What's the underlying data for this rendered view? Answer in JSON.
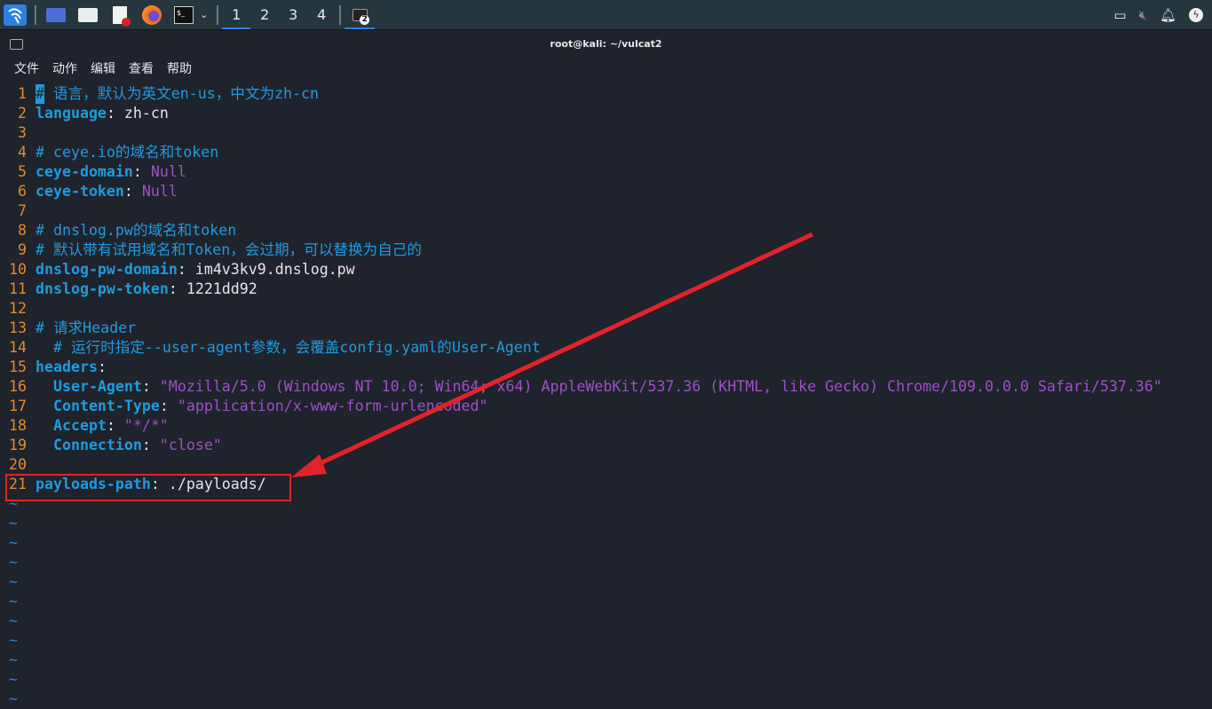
{
  "taskbar": {
    "workspaces": [
      "1",
      "2",
      "3",
      "4"
    ],
    "active_workspace": "1",
    "terminal_badge": "2"
  },
  "window": {
    "title": "root@kali: ~/vulcat2"
  },
  "menu": [
    "文件",
    "动作",
    "编辑",
    "查看",
    "帮助"
  ],
  "editor": {
    "lines": [
      {
        "n": "1",
        "segs": [
          [
            "cursor",
            "#"
          ],
          [
            "c",
            " 语言，默认为英文en-us，中文为zh-cn"
          ]
        ]
      },
      {
        "n": "2",
        "segs": [
          [
            "k",
            "language"
          ],
          [
            "p",
            ": zh-cn"
          ]
        ]
      },
      {
        "n": "3",
        "segs": []
      },
      {
        "n": "4",
        "segs": [
          [
            "c",
            "# ceye.io的域名和token"
          ]
        ]
      },
      {
        "n": "5",
        "segs": [
          [
            "k",
            "ceye-domain"
          ],
          [
            "p",
            ": "
          ],
          [
            "n",
            "Null"
          ]
        ]
      },
      {
        "n": "6",
        "segs": [
          [
            "k",
            "ceye-token"
          ],
          [
            "p",
            ": "
          ],
          [
            "n",
            "Null"
          ]
        ]
      },
      {
        "n": "7",
        "segs": []
      },
      {
        "n": "8",
        "segs": [
          [
            "c",
            "# dnslog.pw的域名和token"
          ]
        ]
      },
      {
        "n": "9",
        "segs": [
          [
            "c",
            "# 默认带有试用域名和Token，会过期，可以替换为自己的"
          ]
        ]
      },
      {
        "n": "10",
        "segs": [
          [
            "k",
            "dnslog-pw-domain"
          ],
          [
            "p",
            ": im4v3kv9.dnslog.pw"
          ]
        ]
      },
      {
        "n": "11",
        "segs": [
          [
            "k",
            "dnslog-pw-token"
          ],
          [
            "p",
            ": 1221dd92"
          ]
        ]
      },
      {
        "n": "12",
        "segs": []
      },
      {
        "n": "13",
        "segs": [
          [
            "c",
            "# 请求Header"
          ]
        ]
      },
      {
        "n": "14",
        "segs": [
          [
            "c",
            "  # 运行时指定--user-agent参数，会覆盖config.yaml的User-Agent"
          ]
        ]
      },
      {
        "n": "15",
        "segs": [
          [
            "k",
            "headers"
          ],
          [
            "p",
            ":"
          ]
        ]
      },
      {
        "n": "16",
        "segs": [
          [
            "p",
            "  "
          ],
          [
            "k",
            "User-Agent"
          ],
          [
            "p",
            ": "
          ],
          [
            "s",
            "\"Mozilla/5.0 (Windows NT 10.0; Win64; x64) AppleWebKit/537.36 (KHTML, like Gecko) Chrome/109.0.0.0 Safari/537.36\""
          ]
        ]
      },
      {
        "n": "17",
        "segs": [
          [
            "p",
            "  "
          ],
          [
            "k",
            "Content-Type"
          ],
          [
            "p",
            ": "
          ],
          [
            "s",
            "\"application/x-www-form-urlencoded\""
          ]
        ]
      },
      {
        "n": "18",
        "segs": [
          [
            "p",
            "  "
          ],
          [
            "k",
            "Accept"
          ],
          [
            "p",
            ": "
          ],
          [
            "s",
            "\"*/*\""
          ]
        ]
      },
      {
        "n": "19",
        "segs": [
          [
            "p",
            "  "
          ],
          [
            "k",
            "Connection"
          ],
          [
            "p",
            ": "
          ],
          [
            "s",
            "\"close\""
          ]
        ]
      },
      {
        "n": "20",
        "segs": []
      },
      {
        "n": "21",
        "segs": [
          [
            "k",
            "payloads-path"
          ],
          [
            "p",
            ": ./payloads/"
          ]
        ]
      }
    ],
    "empty_marker": "~",
    "empty_count": 11
  },
  "annotation": {
    "color": "#e2242a"
  }
}
